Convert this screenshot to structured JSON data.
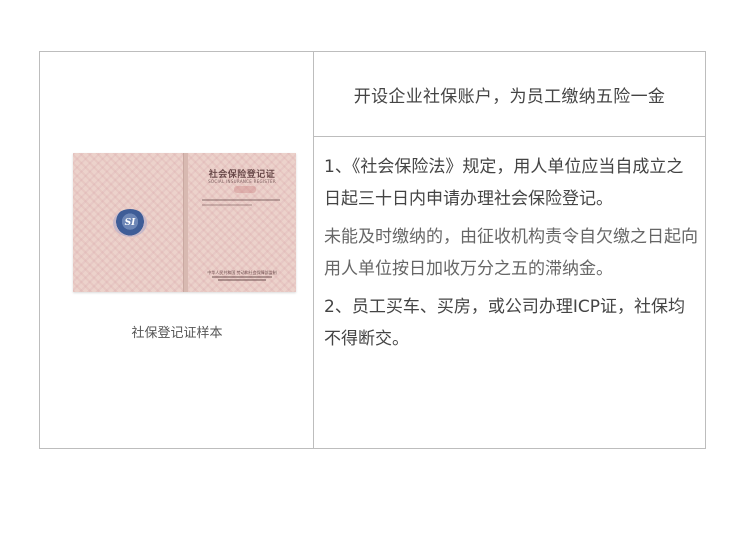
{
  "image_caption": "社保登记证样本",
  "certificate": {
    "title": "社会保险登记证",
    "subtitle": "SOCIAL INSURANCE REGISTER",
    "emblem_text": "SI",
    "footer": "中华人民共和国 劳动和社会保障部监制"
  },
  "header": {
    "title": "开设企业社保账户，为员工缴纳五险一金"
  },
  "body": {
    "paragraph_1": "1、《社会保险法》规定，用人单位应当自成立之日起三十日内申请办理社会保险登记。",
    "paragraph_2": "未能及时缴纳的，由征收机构责令自欠缴之日起向用人单位按日加收万分之五的滞纳金。",
    "paragraph_3": "2、员工买车、买房，或公司办理ICP证，社保均不得断交。"
  }
}
